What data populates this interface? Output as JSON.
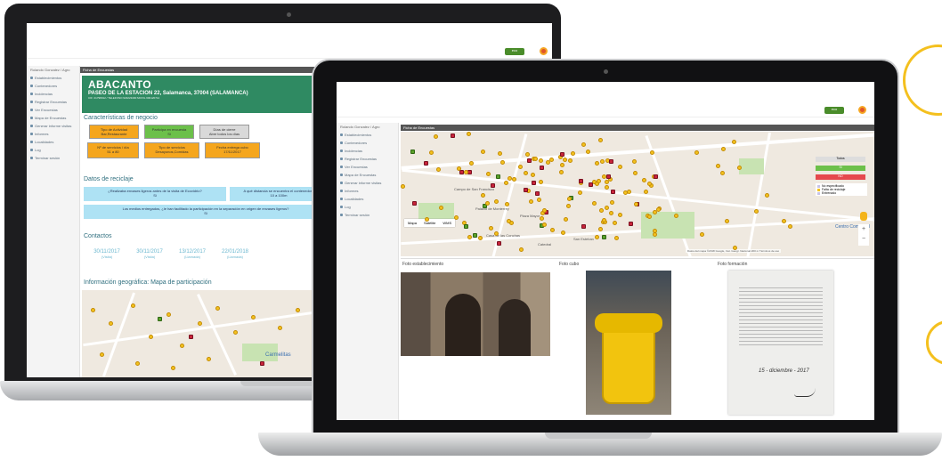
{
  "back_app": {
    "sidebar": {
      "user": "Rolando Gonzalez / Agro",
      "items": [
        "Establecimientos",
        "Contenedores",
        "Incidencias",
        "Registrar Encuestas",
        "Ver Encuestas",
        "Mapa de Encuestas",
        "Generar informe visitas",
        "Informes",
        "Localidades",
        "Log",
        "Terminar sesión"
      ]
    },
    "panel_title": "Ficha de Encuestas",
    "hero": {
      "name": "ABACANTO",
      "address": "PASEO DE LA ESTACION 22, Salamanca, 37004 (SALAMANCA)",
      "cif": "CIF: 21798012 / TELEFONO 923223490 MOVIL 600120712"
    },
    "business_title": "Características de negocio",
    "chips": [
      {
        "line1": "Tipo de Actividad",
        "line2": "Bar,Restaurante",
        "color": "#f5a61d"
      },
      {
        "line1": "Participa en encuesta",
        "line2": "Si",
        "color": "#6cc04a"
      },
      {
        "line1": "Días de cierre",
        "line2": "Abre todos los días",
        "color": "#d9d9d9"
      },
      {
        "line1": "Nº de servicios / día",
        "line2": "51 a 80",
        "color": "#f5a61d"
      },
      {
        "line1": "Tipo de servicios",
        "line2": "Desayunos,Comidas",
        "color": "#f5a61d"
      },
      {
        "line1": "Fecha entrega cubo",
        "line2": "17/11/2017",
        "color": "#f5a61d"
      }
    ],
    "recycling_title": "Datos de reciclaje",
    "questions": [
      {
        "q": "¿Realizaba envases ligeros antes de la visita de Ecovidrio?",
        "a": "Si"
      },
      {
        "q": "A qué distancia se encuentra el contenedor?",
        "a": "10 a 100m"
      },
      {
        "q": "Los medios entregados, ¿le han facilitado la participación en la separación en origen de envases ligeros?",
        "a": "Si"
      }
    ],
    "contacts_title": "Contactos",
    "contacts": [
      {
        "date": "30/11/2017",
        "status": "(Visita)"
      },
      {
        "date": "30/11/2017",
        "status": "(Visita)"
      },
      {
        "date": "13/12/2017",
        "status": "(Llamada)"
      },
      {
        "date": "22/01/2018",
        "status": "(Llamada)"
      }
    ],
    "geo_title": "Información geográfica: Mapa de participación",
    "map_label": "Carmelitas"
  },
  "front_app": {
    "sidebar": {
      "user": "Rolando Gonzalez / Agro",
      "items": [
        "Establecimientos",
        "Contenedores",
        "Incidencias",
        "Registrar Encuestas",
        "Ver Encuestas",
        "Mapa de Encuestas",
        "Generar informe visitas",
        "Informes",
        "Localidades",
        "Log",
        "Terminar sesión"
      ]
    },
    "panel_title": "Ficha de Encuestas",
    "map": {
      "labels": [
        "Palacio de Monterrey",
        "Plaza Mayor",
        "Casa de las Conchas",
        "Centro Comercial",
        "Catedral",
        "San Esteban",
        "Campo de San Francisco"
      ],
      "types": [
        "Mapa",
        "Satélite",
        "WMS"
      ],
      "attribution": "Datos del mapa ©2018 Google, Inst. Geogr. Nacional   200 m   Términos de uso"
    },
    "legend": [
      {
        "label": "Todos",
        "color": "#dddddd"
      },
      {
        "label": "Si",
        "color": "#6cc04a"
      },
      {
        "label": "NO",
        "color": "#e5484d"
      }
    ],
    "legend_checks": [
      {
        "label": "No especificado",
        "color": "#c8c4e8"
      },
      {
        "label": "Falta de reciclaje",
        "color": "#f4c21e"
      },
      {
        "label": "Entrenado",
        "color": "#c8c4e8"
      }
    ],
    "photos": [
      {
        "title": "Foto establecimiento"
      },
      {
        "title": "Foto cubo"
      },
      {
        "title": "Foto formación"
      }
    ],
    "document_date": "15 - diciembre - 2017"
  },
  "colors": {
    "accent": "#2f8a62",
    "marker_yellow": "#f4c21e",
    "marker_red": "#c8243a"
  },
  "icons": [
    "camera-icon",
    "logo-icon",
    "avatar-icon",
    "zoom-in-icon",
    "zoom-out-icon",
    "pegman-icon"
  ]
}
